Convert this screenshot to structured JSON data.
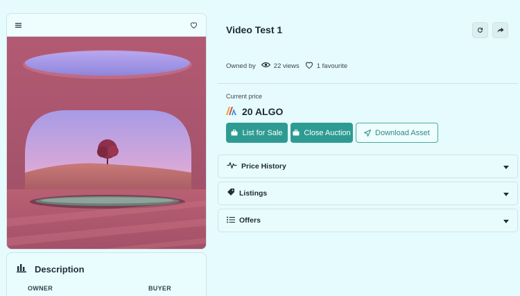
{
  "item": {
    "title": "Video Test 1",
    "owned_by_label": "Owned by",
    "views": "22 views",
    "favourites": "1 favourite"
  },
  "price": {
    "label": "Current price",
    "value": "20 ALGO"
  },
  "actions": {
    "list_for_sale": "List for Sale",
    "close_auction": "Close Auction",
    "download_asset": "Download Asset"
  },
  "sections": [
    {
      "label": "Price History",
      "icon": "activity-icon"
    },
    {
      "label": "Listings",
      "icon": "tag-icon"
    },
    {
      "label": "Offers",
      "icon": "list-icon"
    }
  ],
  "description": {
    "title": "Description",
    "col_owner": "OWNER",
    "col_buyer": "BUYER"
  },
  "colors": {
    "accent": "#2e9b93",
    "background": "#e6fbfd"
  }
}
